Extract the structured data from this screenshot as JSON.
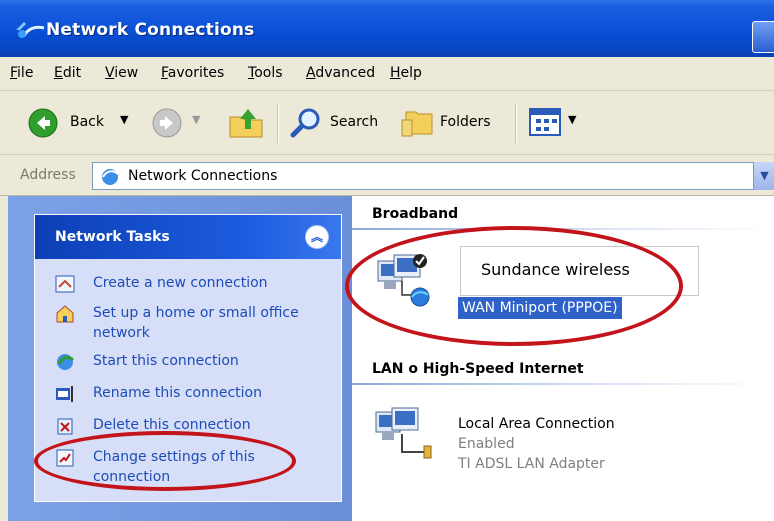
{
  "window": {
    "title": "Network Connections"
  },
  "menu": [
    "File",
    "Edit",
    "View",
    "Favorites",
    "Tools",
    "Advanced",
    "Help"
  ],
  "toolbar": {
    "back_label": "Back",
    "search_label": "Search",
    "folders_label": "Folders"
  },
  "address": {
    "label": "Address",
    "value": "Network Connections"
  },
  "tasks": {
    "title": "Network Tasks",
    "items": [
      {
        "label": "Create a new connection",
        "icon": "new-connection-icon"
      },
      {
        "label": "Set up a home or small office network",
        "icon": "home-network-icon"
      },
      {
        "label": "Start this connection",
        "icon": "start-connection-icon"
      },
      {
        "label": "Rename this connection",
        "icon": "rename-icon"
      },
      {
        "label": "Delete this connection",
        "icon": "delete-icon"
      },
      {
        "label": "Change settings of this connection",
        "icon": "settings-icon"
      }
    ]
  },
  "content": {
    "broadband_header": "Broadband",
    "broadband_connection": {
      "device": "WAN Miniport (PPPOE)"
    },
    "lan_header": "LAN o  High-Speed Internet",
    "lan_connection": {
      "name": "Local Area Connection",
      "status": "Enabled",
      "device": "TI ADSL LAN Adapter"
    }
  },
  "annotation": {
    "callout_text": "Sundance wireless",
    "highlight_color": "#c3141b"
  },
  "colors": {
    "titlebar_blue": "#0a4fd6",
    "taskpane_blue": "#7ba2e7",
    "link_blue": "#1d4bb8",
    "selection_blue": "#2f62c8"
  }
}
